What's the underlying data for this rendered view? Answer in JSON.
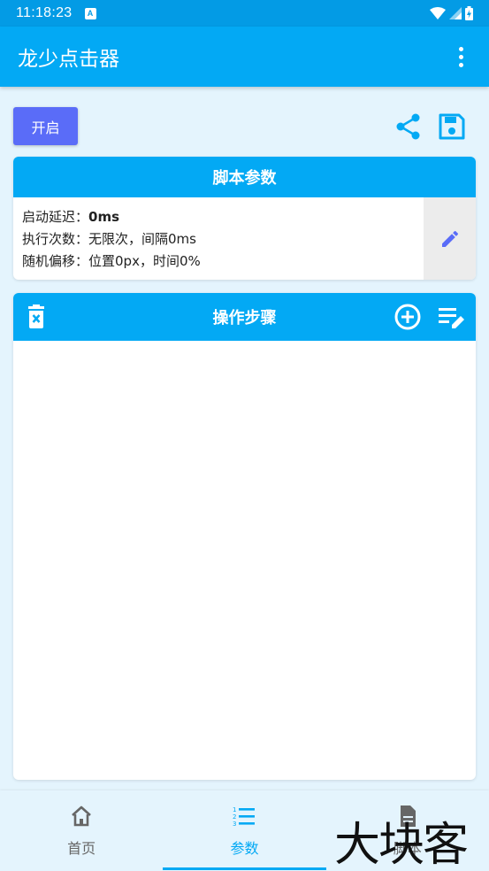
{
  "status_bar": {
    "time": "11:18:23",
    "notification_icon": "A"
  },
  "app_bar": {
    "title": "龙少点击器",
    "menu_icon": "more-vert-icon"
  },
  "toolbar": {
    "start_label": "开启",
    "share_icon": "share-icon",
    "save_icon": "save-icon"
  },
  "params_card": {
    "title": "脚本参数",
    "lines": [
      {
        "label": "启动延迟：",
        "value": "0ms"
      },
      {
        "label": "执行次数：",
        "value": "无限次，间隔0ms"
      },
      {
        "label": "随机偏移：",
        "value": "位置0px，时间0%"
      }
    ],
    "edit_icon": "pencil-icon"
  },
  "steps_card": {
    "title": "操作步骤",
    "icons": [
      "trash-icon",
      "add-circle-icon",
      "list-edit-icon"
    ],
    "items": []
  },
  "bottom_nav": {
    "items": [
      {
        "label": "首页",
        "icon": "home-icon",
        "active": false
      },
      {
        "label": "参数",
        "icon": "list-numbered-icon",
        "active": true
      },
      {
        "label": "脚本",
        "icon": "document-icon",
        "active": false
      }
    ]
  },
  "watermark": "大块客",
  "colors": {
    "primary": "#03a9f4",
    "status": "#039be5",
    "button": "#5a6cf8",
    "background": "#e4f4fd"
  }
}
